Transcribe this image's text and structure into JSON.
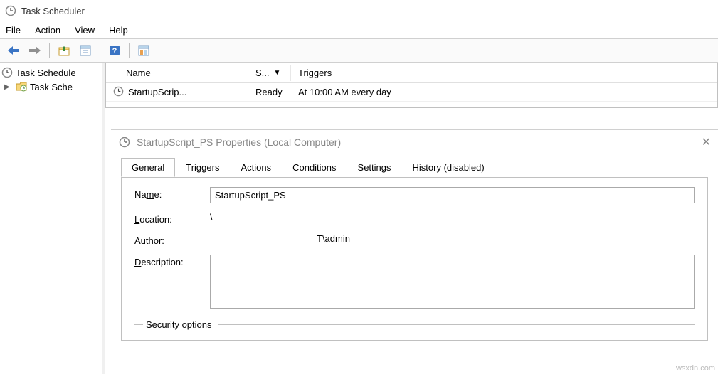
{
  "window": {
    "title": "Task Scheduler"
  },
  "menu": {
    "file": "File",
    "action": "Action",
    "view": "View",
    "help": "Help"
  },
  "tree": {
    "root_label": "Task Schedule",
    "child_label": "Task Sche"
  },
  "task_list": {
    "columns": {
      "name": "Name",
      "status": "S...",
      "triggers": "Triggers"
    },
    "rows": [
      {
        "name": "StartupScrip...",
        "status": "Ready",
        "triggers": "At 10:00 AM every day"
      }
    ]
  },
  "properties": {
    "title": "StartupScript_PS Properties (Local Computer)",
    "tabs": {
      "general": "General",
      "triggers": "Triggers",
      "actions": "Actions",
      "conditions": "Conditions",
      "settings": "Settings",
      "history": "History (disabled)"
    },
    "form": {
      "name_label_pre": "Na",
      "name_label_u": "m",
      "name_label_post": "e:",
      "name_value": "StartupScript_PS",
      "location_label_pre": "",
      "location_label_u": "L",
      "location_label_post": "ocation:",
      "location_value": "\\",
      "author_label": "Author:",
      "author_value": "T\\admin",
      "desc_label_pre": "",
      "desc_label_u": "D",
      "desc_label_post": "escription:",
      "desc_value": ""
    },
    "security_label": "Security options"
  },
  "watermark": "wsxdn.com"
}
